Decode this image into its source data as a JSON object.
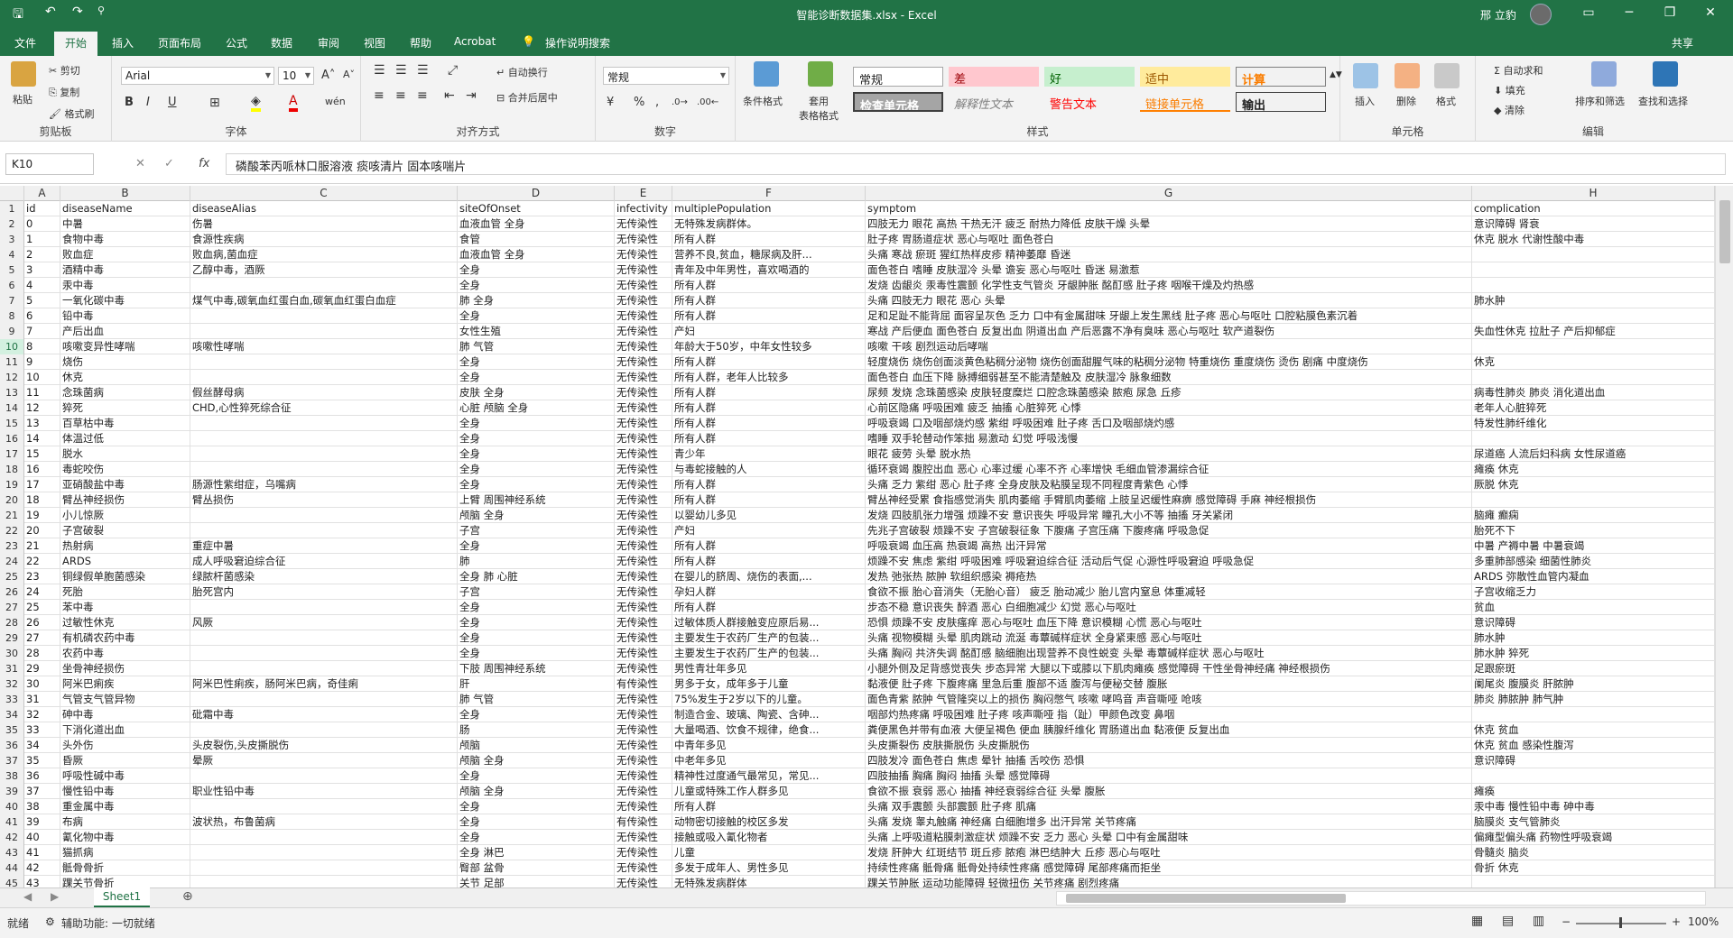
{
  "title": {
    "text": "智能诊断数据集.xlsx - Excel",
    "user": "邢 立豹"
  },
  "tabs": [
    "文件",
    "开始",
    "插入",
    "页面布局",
    "公式",
    "数据",
    "审阅",
    "视图",
    "帮助",
    "Acrobat",
    "操作说明搜索"
  ],
  "share": "共享",
  "ribbon": {
    "clipboard": {
      "paste": "粘贴",
      "cut": "剪切",
      "copy": "复制",
      "painter": "格式刷",
      "label": "剪贴板"
    },
    "font": {
      "name": "Arial",
      "size": "10",
      "label": "字体"
    },
    "align": {
      "wrap": "自动换行",
      "merge": "合并后居中",
      "label": "对齐方式"
    },
    "number": {
      "format": "常规",
      "label": "数字"
    },
    "styles": {
      "cond": "条件格式",
      "table": "套用\n表格格式",
      "normal": "常规",
      "bad": "差",
      "good": "好",
      "neutral": "适中",
      "calc": "计算",
      "check": "检查单元格",
      "explain": "解释性文本",
      "warn": "警告文本",
      "link": "链接单元格",
      "output": "输出",
      "label": "样式"
    },
    "cells": {
      "insert": "插入",
      "delete": "删除",
      "format": "格式",
      "label": "单元格"
    },
    "editing": {
      "autosum": "自动求和",
      "fill": "填充",
      "clear": "清除",
      "sort": "排序和筛选",
      "find": "查找和选择",
      "label": "编辑"
    }
  },
  "formula": {
    "namebox": "K10",
    "content": "磷酸苯丙哌林口服溶液 痰咳清片 固本咳喘片"
  },
  "columns": [
    "A",
    "B",
    "C",
    "D",
    "E",
    "F",
    "G",
    "H"
  ],
  "rows": [
    [
      "1",
      "id",
      "diseaseName",
      "diseaseAlias",
      "siteOfOnset",
      "infectivity",
      "multiplePopulation",
      "symptom",
      "complication"
    ],
    [
      "2",
      "0",
      "中暑",
      "伤暑",
      "血液血管 全身",
      "无传染性",
      "无特殊发病群体。",
      "四肢无力 眼花 高热 干热无汗 疲乏 耐热力降低 皮肤干燥 头晕",
      "意识障碍 肾衰"
    ],
    [
      "3",
      "1",
      "食物中毒",
      "食源性疾病",
      "食管",
      "无传染性",
      "所有人群",
      "肚子疼 胃肠道症状 恶心与呕吐 面色苍白",
      "休克 脱水 代谢性酸中毒"
    ],
    [
      "4",
      "2",
      "败血症",
      "败血病,菌血症",
      "血液血管 全身",
      "无传染性",
      "营养不良,贫血，糖尿病及肝...",
      "头痛 寒战 瘀斑 猩红热样皮疹 精神萎靡 昏迷",
      ""
    ],
    [
      "5",
      "3",
      "酒精中毒",
      "乙醇中毒，酒厥",
      "全身",
      "无传染性",
      "青年及中年男性，喜欢喝酒的",
      "面色苍白 嗜睡 皮肤湿冷 头晕 谵妄 恶心与呕吐 昏迷 易激惹",
      ""
    ],
    [
      "6",
      "4",
      "汞中毒",
      "",
      "全身",
      "无传染性",
      "所有人群",
      "发烧 齿龈炎 汞毒性震颤 化学性支气管炎 牙龈肿胀 酩酊感 肚子疼 咽喉干燥及灼热感",
      ""
    ],
    [
      "7",
      "5",
      "一氧化碳中毒",
      "煤气中毒,碳氧血红蛋白血,碳氧血红蛋白血症",
      "肺 全身",
      "无传染性",
      "所有人群",
      "头痛 四肢无力 眼花 恶心 头晕",
      "肺水肿"
    ],
    [
      "8",
      "6",
      "铅中毒",
      "",
      "全身",
      "无传染性",
      "所有人群",
      "足和足趾不能背屈 面容呈灰色 乏力 口中有金属甜味 牙龈上发生黑线 肚子疼 恶心与呕吐 口腔粘膜色素沉着",
      ""
    ],
    [
      "9",
      "7",
      "产后出血",
      "",
      "女性生殖",
      "无传染性",
      "产妇",
      "寒战 产后便血 面色苍白 反复出血 阴道出血 产后恶露不净有臭味 恶心与呕吐 软产道裂伤",
      "失血性休克 拉肚子 产后抑郁症"
    ],
    [
      "10",
      "8",
      "咳嗽变异性哮喘",
      "咳嗽性哮喘",
      "肺 气管",
      "无传染性",
      "年龄大于50岁，中年女性较多",
      "咳嗽 干咳 剧烈运动后哮喘",
      ""
    ],
    [
      "11",
      "9",
      "烧伤",
      "",
      "全身",
      "无传染性",
      "所有人群",
      "轻度烧伤 烧伤创面淡黄色粘稠分泌物 烧伤创面甜腥气味的粘稠分泌物 特重烧伤 重度烧伤 烫伤 剧痛 中度烧伤",
      "休克"
    ],
    [
      "12",
      "10",
      "休克",
      "",
      "全身",
      "无传染性",
      "所有人群，老年人比较多",
      "面色苍白 血压下降 脉搏细弱甚至不能清楚触及 皮肤湿冷 脉象细数",
      ""
    ],
    [
      "13",
      "11",
      "念珠菌病",
      "假丝酵母病",
      "皮肤 全身",
      "无传染性",
      "所有人群",
      "尿频 发烧 念珠菌感染 皮肤轻度糜烂 口腔念珠菌感染 脓疱 尿急 丘疹",
      "病毒性肺炎 肺炎 消化道出血"
    ],
    [
      "14",
      "12",
      "猝死",
      "CHD,心性猝死综合征",
      "心脏 颅脑 全身",
      "无传染性",
      "所有人群",
      "心前区隐痛 呼吸困难 疲乏 抽搐 心脏猝死 心悸",
      "老年人心脏猝死"
    ],
    [
      "15",
      "13",
      "百草枯中毒",
      "",
      "全身",
      "无传染性",
      "所有人群",
      "呼吸衰竭 口及咽部烧灼感 紫绀 呼吸困难 肚子疼 舌口及咽部烧灼感",
      "特发性肺纤维化"
    ],
    [
      "16",
      "14",
      "体温过低",
      "",
      "全身",
      "无传染性",
      "所有人群",
      "嗜睡 双手轮替动作笨拙 易激动 幻觉 呼吸浅慢",
      ""
    ],
    [
      "17",
      "15",
      "脱水",
      "",
      "全身",
      "无传染性",
      "青少年",
      "眼花 疲劳 头晕 脱水热",
      "尿道癌 人流后妇科病 女性尿道癌"
    ],
    [
      "18",
      "16",
      "毒蛇咬伤",
      "",
      "全身",
      "无传染性",
      "与毒蛇接触的人",
      "循环衰竭 腹腔出血 恶心 心率过缓 心率不齐 心率增快 毛细血管渗漏综合征",
      "瘫痪 休克"
    ],
    [
      "19",
      "17",
      "亚硝酸盐中毒",
      "肠源性紫绀症，乌嘴病",
      "全身",
      "无传染性",
      "所有人群",
      "头痛 乏力 紫绀 恶心 肚子疼 全身皮肤及粘膜呈现不同程度青紫色 心悸",
      "厥脱 休克"
    ],
    [
      "20",
      "18",
      "臂丛神经损伤",
      "臂丛损伤",
      "上臂 周围神经系统",
      "无传染性",
      "所有人群",
      "臂丛神经受累 食指感觉消失 肌肉萎缩 手臂肌肉萎缩 上肢呈迟缓性麻痹 感觉障碍 手麻 神经根损伤",
      ""
    ],
    [
      "21",
      "19",
      "小儿惊厥",
      "",
      "颅脑 全身",
      "无传染性",
      "以婴幼儿多见",
      "发烧 四肢肌张力增强 烦躁不安 意识丧失 呼吸异常 瞳孔大小不等 抽搐 牙关紧闭",
      "脑瘫 癫痫"
    ],
    [
      "22",
      "20",
      "子宫破裂",
      "",
      "子宫",
      "无传染性",
      "产妇",
      "先兆子宫破裂 烦躁不安 子宫破裂征象 下腹痛 子宫压痛 下腹疼痛 呼吸急促",
      "胎死不下"
    ],
    [
      "23",
      "21",
      "热射病",
      "重症中暑",
      "全身",
      "无传染性",
      "所有人群",
      "呼吸衰竭 血压高 热衰竭 高热 出汗异常",
      "中暑 产褥中暑 中暑衰竭"
    ],
    [
      "24",
      "22",
      "ARDS",
      "成人呼吸窘迫综合征",
      "肺",
      "无传染性",
      "所有人群",
      "烦躁不安 焦虑 紫绀 呼吸困难 呼吸窘迫综合征 活动后气促 心源性呼吸窘迫 呼吸急促",
      "多重肺部感染 细菌性肺炎"
    ],
    [
      "25",
      "23",
      "铜绿假单胞菌感染",
      "绿脓杆菌感染",
      "全身 肺 心脏",
      "无传染性",
      "在婴儿的脐周、烧伤的表面,...",
      "发热 弛张热 脓肿 软组织感染 褥疮热",
      "ARDS 弥散性血管内凝血"
    ],
    [
      "26",
      "24",
      "死胎",
      "胎死宫内",
      "子宫",
      "无传染性",
      "孕妇人群",
      "食欲不振 胎心音消失（无胎心音） 疲乏 胎动减少 胎儿宫内窒息 体重减轻",
      "子宫收缩乏力"
    ],
    [
      "27",
      "25",
      "苯中毒",
      "",
      "全身",
      "无传染性",
      "所有人群",
      "步态不稳 意识丧失 醉酒 恶心 白细胞减少 幻觉 恶心与呕吐",
      "贫血"
    ],
    [
      "28",
      "26",
      "过敏性休克",
      "风厥",
      "全身",
      "无传染性",
      "过敏体质人群接触变应原后易...",
      "恐惧 烦躁不安 皮肤瘙痒 恶心与呕吐 血压下降 意识模糊 心慌 恶心与呕吐",
      "意识障碍"
    ],
    [
      "29",
      "27",
      "有机磷农药中毒",
      "",
      "全身",
      "无传染性",
      "主要发生于农药厂生产的包装...",
      "头痛 视物模糊 头晕 肌肉跳动 流涎 毒蕈碱样症状 全身紧束感 恶心与呕吐",
      "肺水肿"
    ],
    [
      "30",
      "28",
      "农药中毒",
      "",
      "全身",
      "无传染性",
      "主要发生于农药厂生产的包装...",
      "头痛 胸闷 共济失调 酩酊感 脑细胞出现营养不良性蜕变 头晕 毒蕈碱样症状 恶心与呕吐",
      "肺水肿 猝死"
    ],
    [
      "31",
      "29",
      "坐骨神经损伤",
      "",
      "下肢 周围神经系统",
      "无传染性",
      "男性青壮年多见",
      "小腿外侧及足背感觉丧失 步态异常 大腿以下或膝以下肌肉瘫痪 感觉障碍 干性坐骨神经痛 神经根损伤",
      "足跟瘀斑"
    ],
    [
      "32",
      "30",
      "阿米巴痢疾",
      "阿米巴性痢疾，肠阿米巴病，奇佳痢",
      "肝",
      "有传染性",
      "男多于女，成年多于儿童",
      "黏液便 肚子疼 下腹疼痛 里急后重 腹部不适 腹泻与便秘交替 腹胀",
      "阑尾炎 腹膜炎 肝脓肿"
    ],
    [
      "33",
      "31",
      "气管支气管异物",
      "",
      "肺 气管",
      "无传染性",
      "75%发生于2岁以下的儿童。",
      "面色青紫 脓肿 气管隆突以上的损伤 胸闷憋气 咳嗽 哮鸣音 声音嘶哑 呛咳",
      "肺炎 肺脓肿 肺气肿"
    ],
    [
      "34",
      "32",
      "砷中毒",
      "砒霜中毒",
      "全身",
      "无传染性",
      "制造合金、玻璃、陶瓷、含砷...",
      "咽部灼热疼痛 呼吸困难 肚子疼 咳声嘶哑 指（趾）甲颜色改变 鼻咽",
      ""
    ],
    [
      "35",
      "33",
      "下消化道出血",
      "",
      "肠",
      "无传染性",
      "大量喝酒、饮食不规律，绝食...",
      "粪便黑色并带有血液 大便呈褐色 便血 胰腺纤维化 胃肠道出血 黏液便 反复出血",
      "休克 贫血"
    ],
    [
      "36",
      "34",
      "头外伤",
      "头皮裂伤,头皮撕脱伤",
      "颅脑",
      "无传染性",
      "中青年多见",
      "头皮撕裂伤 皮肤撕脱伤 头皮撕脱伤",
      "休克 贫血 感染性腹泻"
    ],
    [
      "37",
      "35",
      "昏厥",
      "晕厥",
      "颅脑 全身",
      "无传染性",
      "中老年多见",
      "四肢发冷 面色苍白 焦虑 晕针 抽搐 舌咬伤 恐惧",
      "意识障碍"
    ],
    [
      "38",
      "36",
      "呼吸性碱中毒",
      "",
      "全身",
      "无传染性",
      "精神性过度通气最常见，常见...",
      "四肢抽搐 胸痛 胸闷 抽搐 头晕 感觉障碍",
      ""
    ],
    [
      "39",
      "37",
      "慢性铅中毒",
      "职业性铅中毒",
      "颅脑 全身",
      "无传染性",
      "儿童或特殊工作人群多见",
      "食欲不振 衰弱 恶心 抽搐 神经衰弱综合征 头晕 腹胀",
      "瘫痪"
    ],
    [
      "40",
      "38",
      "重金属中毒",
      "",
      "全身",
      "无传染性",
      "所有人群",
      "头痛 双手震颤 头部震颤 肚子疼 肌痛",
      "汞中毒 慢性铅中毒 砷中毒"
    ],
    [
      "41",
      "39",
      "布病",
      "波状热，布鲁菌病",
      "全身",
      "有传染性",
      "动物密切接触的校区多发",
      "头痛 发烧 睾丸触痛 神经痛 白细胞增多 出汗异常 关节疼痛",
      "脑膜炎 支气管肺炎"
    ],
    [
      "42",
      "40",
      "氰化物中毒",
      "",
      "全身",
      "无传染性",
      "接触或吸入氰化物者",
      "头痛 上呼吸道粘膜刺激症状 烦躁不安 乏力 恶心 头晕 口中有金属甜味",
      "偏瘫型偏头痛 药物性呼吸衰竭"
    ],
    [
      "43",
      "41",
      "猫抓病",
      "",
      "全身 淋巴",
      "无传染性",
      "儿童",
      "发烧 肝肿大 红斑结节 斑丘疹 脓疱 淋巴结肿大 丘疹 恶心与呕吐",
      "骨髓炎 脑炎"
    ],
    [
      "44",
      "42",
      "骶骨骨折",
      "",
      "臀部 盆骨",
      "无传染性",
      "多发于成年人、男性多见",
      "持续性疼痛 骶骨痛 骶骨处持续性疼痛 感觉障碍 尾部疼痛而拒坐",
      "骨折 休克"
    ],
    [
      "45",
      "43",
      "踝关节骨折",
      "",
      "关节 足部",
      "无传染性",
      "无特殊发病群体",
      "踝关节肿胀 运动功能障碍 轻微扭伤 关节疼痛 剧烈疼痛",
      ""
    ]
  ],
  "sheet": "Sheet1",
  "status": {
    "ready": "就绪",
    "access": "辅助功能: 一切就绪",
    "zoom": "100%"
  },
  "colors": {
    "accent": "#217346"
  }
}
